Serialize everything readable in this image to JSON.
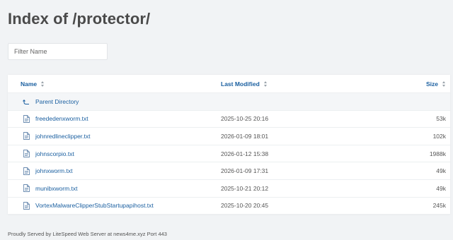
{
  "page": {
    "title": "Index of /protector/",
    "filter_placeholder": "Filter Name"
  },
  "table": {
    "headers": {
      "name": "Name",
      "modified": "Last Modified",
      "size": "Size"
    },
    "parent_label": "Parent Directory",
    "rows": [
      {
        "name": "freededenxworm.txt",
        "modified": "2025-10-25 20:16",
        "size": "53k"
      },
      {
        "name": "johnredlineclipper.txt",
        "modified": "2026-01-09 18:01",
        "size": "102k"
      },
      {
        "name": "johnscorpio.txt",
        "modified": "2026-01-12 15:38",
        "size": "1988k"
      },
      {
        "name": "johnxworm.txt",
        "modified": "2026-01-09 17:31",
        "size": "49k"
      },
      {
        "name": "munibxworm.txt",
        "modified": "2025-10-21 20:12",
        "size": "49k"
      },
      {
        "name": "VortexMalwareClipperStubStartupapihost.txt",
        "modified": "2025-10-20 20:45",
        "size": "245k"
      }
    ]
  },
  "footer": {
    "text": "Proudly Served by LiteSpeed Web Server at news4me.xyz Port 443"
  },
  "icons": {
    "parent": "parent-directory-arrow-icon",
    "file": "text-file-icon"
  },
  "colors": {
    "link": "#1a5fa0",
    "background": "#f1f3f5"
  }
}
